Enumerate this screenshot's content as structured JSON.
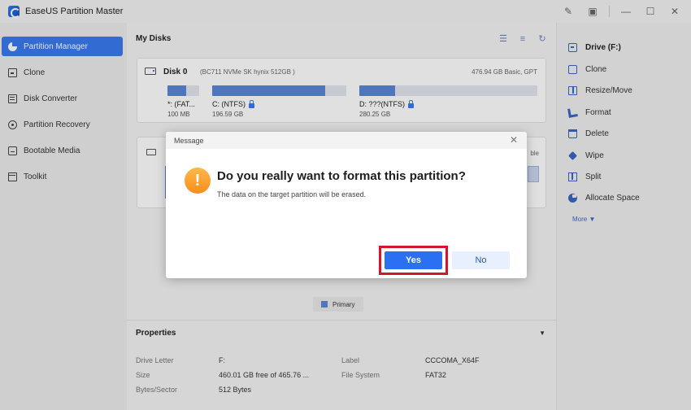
{
  "app": {
    "title": "EaseUS Partition Master"
  },
  "window_controls": [
    "feedback-icon",
    "menu-icon",
    "minimize-icon",
    "maximize-icon",
    "close-icon"
  ],
  "sidebar": {
    "items": [
      {
        "label": "Partition Manager",
        "icon": "pie-chart-icon",
        "active": true
      },
      {
        "label": "Clone",
        "icon": "clone-icon"
      },
      {
        "label": "Disk Converter",
        "icon": "disk-converter-icon"
      },
      {
        "label": "Partition Recovery",
        "icon": "recovery-icon"
      },
      {
        "label": "Bootable Media",
        "icon": "bootable-media-icon"
      },
      {
        "label": "Toolkit",
        "icon": "toolkit-icon"
      }
    ]
  },
  "main": {
    "title": "My Disks",
    "disk0": {
      "name": "Disk 0",
      "model": "(BC711 NVMe SK hynix 512GB )",
      "info": "476.94 GB Basic, GPT",
      "partitions": [
        {
          "label": "*: (FAT...",
          "size": "100 MB",
          "fill": 0.6
        },
        {
          "label": "C: (NTFS)",
          "size": "196.59 GB",
          "fill": 0.84
        },
        {
          "label": "D: ???(NTFS)",
          "size": "280.25 GB",
          "fill": 0.2
        }
      ]
    },
    "disk1": {
      "tag_partial": "ble"
    },
    "legend": {
      "primary": "Primary"
    }
  },
  "properties": {
    "title": "Properties",
    "fields": {
      "drive_letter_label": "Drive Letter",
      "drive_letter_value": "F:",
      "size_label": "Size",
      "size_value": "460.01 GB free of 465.76 ...",
      "bytes_label": "Bytes/Sector",
      "bytes_value": "512 Bytes",
      "label_label": "Label",
      "label_value": "CCCOMA_X64F",
      "fs_label": "File System",
      "fs_value": "FAT32"
    }
  },
  "right_panel": {
    "drive": "Drive (F:)",
    "actions": [
      "Clone",
      "Resize/Move",
      "Format",
      "Delete",
      "Wipe",
      "Split",
      "Allocate Space"
    ],
    "more": "More"
  },
  "dialog": {
    "header": "Message",
    "title": "Do you really want to format this partition?",
    "message": "The data on the target partition will be erased.",
    "yes": "Yes",
    "no": "No"
  },
  "colors": {
    "accent": "#2b6ff2",
    "highlight": "#d0182c",
    "warning": "#f5a623"
  }
}
